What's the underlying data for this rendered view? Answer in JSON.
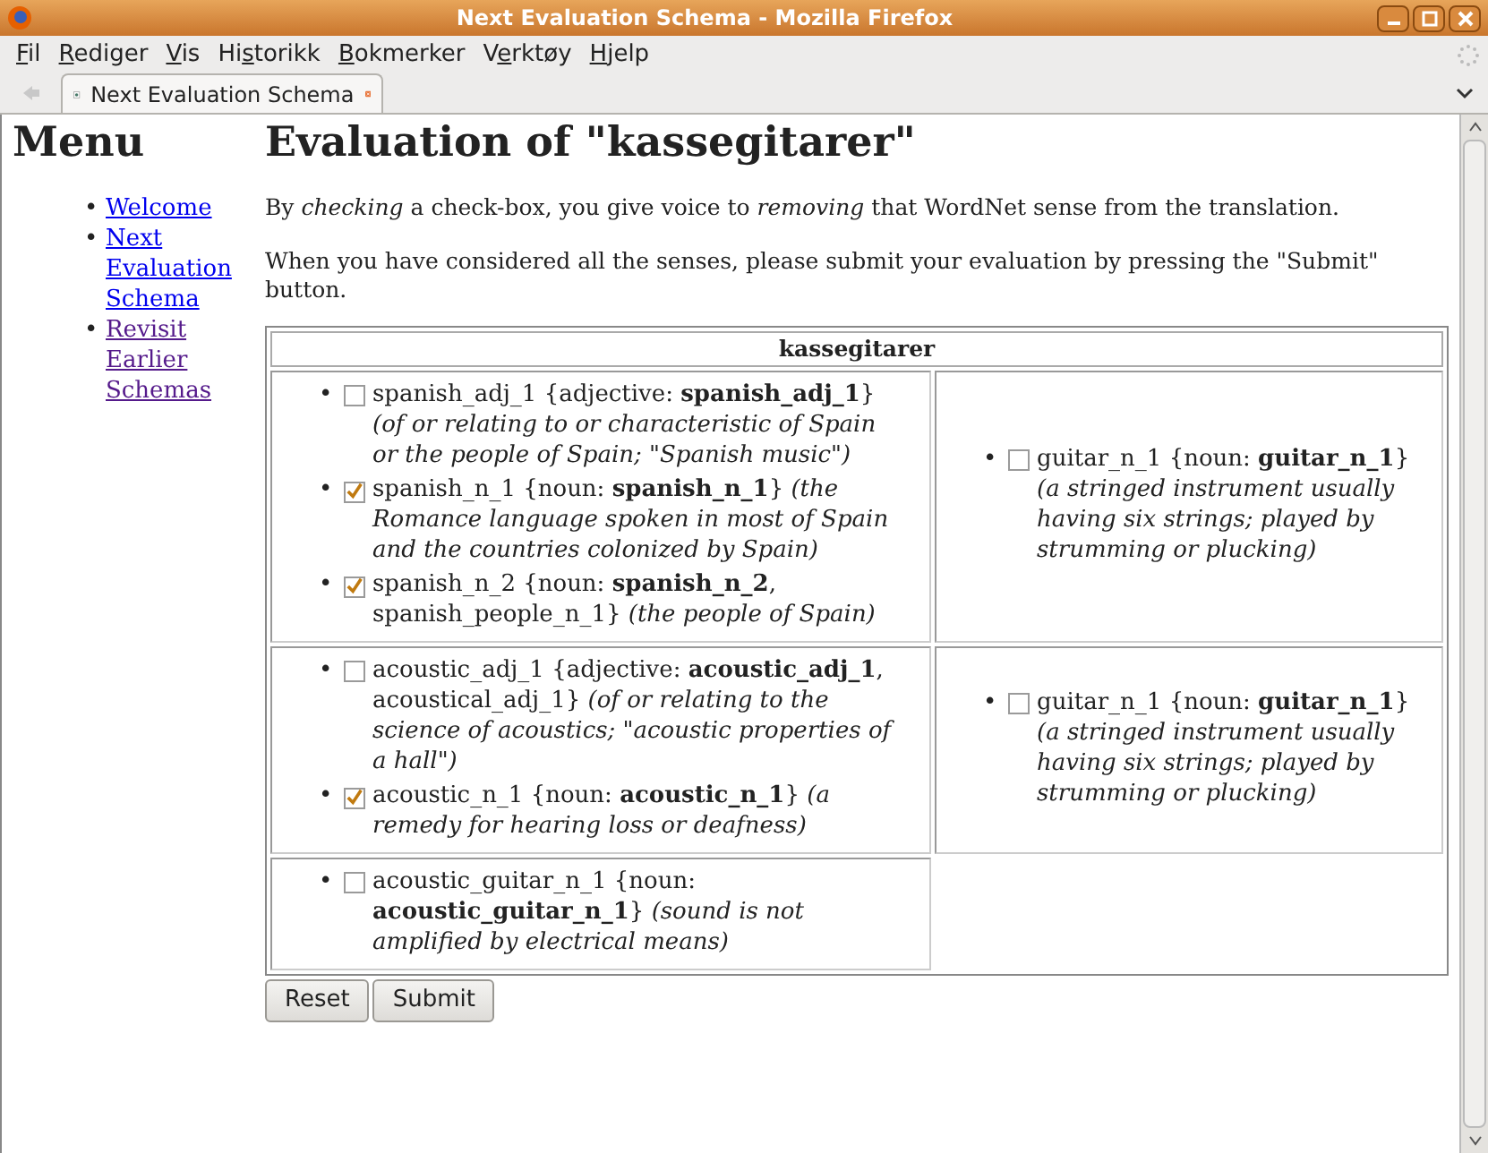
{
  "window": {
    "title": "Next Evaluation Schema - Mozilla Firefox"
  },
  "menu_bar": [
    {
      "key": "F",
      "after": "il"
    },
    {
      "key": "R",
      "after": "ediger"
    },
    {
      "key": "V",
      "after": "is"
    },
    {
      "before": "Hi",
      "key": "s",
      "after": "torikk"
    },
    {
      "key": "B",
      "after": "okmerker"
    },
    {
      "before": "V",
      "key": "e",
      "after": "rktøy"
    },
    {
      "key": "H",
      "after": "jelp"
    }
  ],
  "tabs": [
    {
      "label": "Next Evaluation Schema",
      "selected": true
    }
  ],
  "sidebar": {
    "title": "Menu",
    "links": [
      {
        "bullet": "•",
        "label": "Welcome",
        "visited": false
      },
      {
        "bullet": "•",
        "label": "Next Evaluation Schema",
        "visited": false
      },
      {
        "bullet": "•",
        "label": "Revisit Earlier Schemas",
        "visited": true
      }
    ]
  },
  "heading": "Evaluation of \"kassegitarer\"",
  "paragraphs": [
    "By *checking* a check-box, you give voice to *removing* that WordNet sense from the translation.",
    "When you have considered all the senses, please submit your evaluation by pressing the \"Submit\" button."
  ],
  "table": {
    "header": "kassegitarer",
    "rows": [
      {
        "cells": [
          {
            "senses": [
              {
                "bullet": "•",
                "checked": false,
                "text": "spanish_adj_1 {adjective: **spanish_adj_1**} *(of or relating to or characteristic of Spain or the people of Spain; \"Spanish music\")*"
              },
              {
                "bullet": "•",
                "checked": true,
                "text": "spanish_n_1 {noun: **spanish_n_1**} *(the Romance language spoken in most of Spain and the countries colonized by Spain)*"
              },
              {
                "bullet": "•",
                "checked": true,
                "text": "spanish_n_2 {noun: **spanish_n_2**, spanish_people_n_1} *(the people of Spain)*"
              }
            ]
          },
          {
            "senses": [
              {
                "bullet": "•",
                "checked": false,
                "text": "guitar_n_1 {noun: **guitar_n_1**} *(a stringed instrument usually having six strings; played by strumming or plucking)*"
              }
            ]
          }
        ]
      },
      {
        "cells": [
          {
            "senses": [
              {
                "bullet": "•",
                "checked": false,
                "text": "acoustic_adj_1 {adjective: **acoustic_adj_1**, acoustical_adj_1} *(of or relating to the science of acoustics; \"acoustic properties of a hall\")*"
              },
              {
                "bullet": "•",
                "checked": true,
                "text": "acoustic_n_1 {noun: **acoustic_n_1**} *(a remedy for hearing loss or deafness)*"
              }
            ]
          },
          {
            "senses": [
              {
                "bullet": "•",
                "checked": false,
                "text": "guitar_n_1 {noun: **guitar_n_1**} *(a stringed instrument usually having six strings; played by strumming or plucking)*"
              }
            ]
          }
        ]
      },
      {
        "cells": [
          {
            "senses": [
              {
                "bullet": "•",
                "checked": false,
                "text": "acoustic_guitar_n_1 {noun: **acoustic_guitar_n_1**} *(sound is not amplified by electrical means)*"
              }
            ]
          }
        ]
      }
    ]
  },
  "buttons": [
    "Reset",
    "Submit"
  ]
}
